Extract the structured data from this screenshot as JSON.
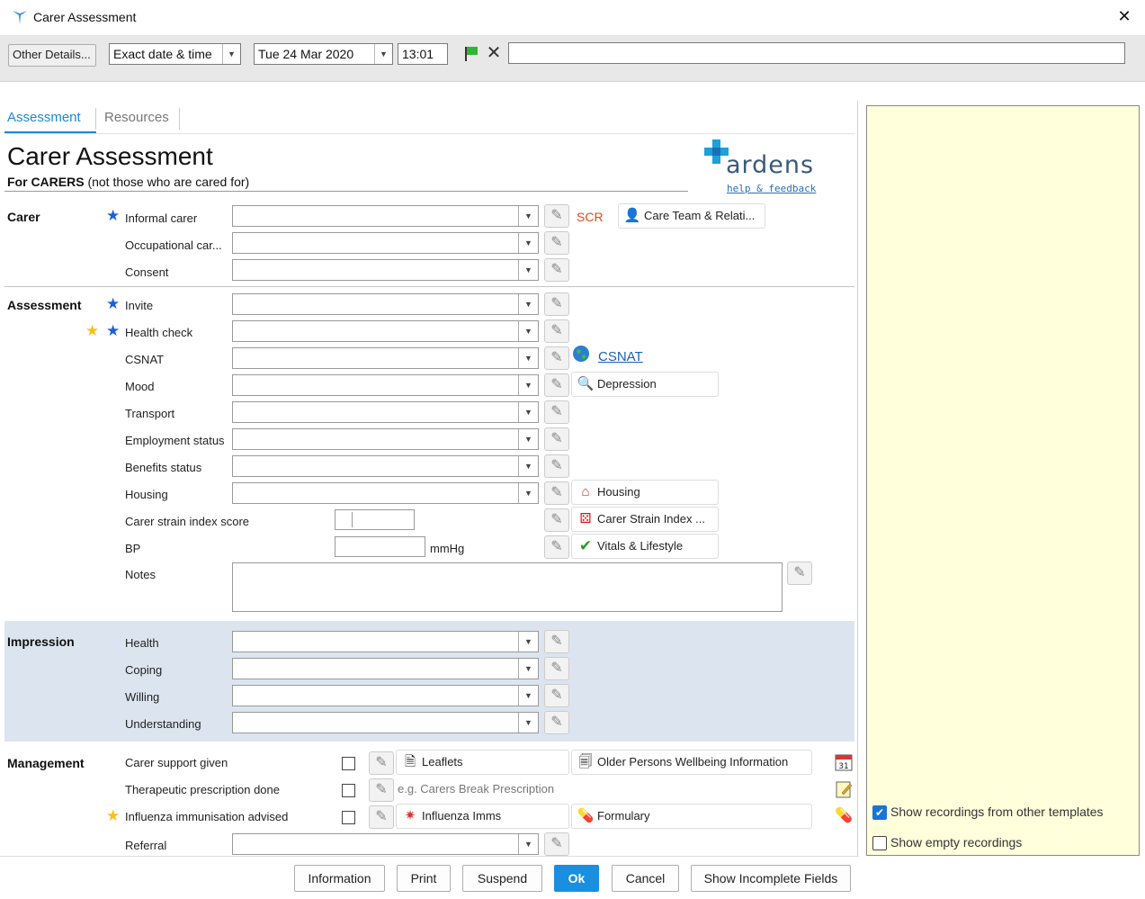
{
  "window": {
    "title": "Carer Assessment"
  },
  "toolbar": {
    "other_details": "Other Details...",
    "date_mode": "Exact date & time",
    "date": "Tue 24 Mar 2020",
    "time": "13:01"
  },
  "tabs": [
    {
      "label": "Assessment"
    },
    {
      "label": "Resources"
    }
  ],
  "heading": {
    "title": "Carer Assessment",
    "subtitle_bold": "For CARERS",
    "subtitle_rest": " (not those who are cared for)"
  },
  "logo": {
    "text": "ardens",
    "link": "help & feedback"
  },
  "sections": {
    "carer": "Carer",
    "assessment": "Assessment",
    "impression": "Impression",
    "management": "Management"
  },
  "fields": {
    "informal_carer": "Informal carer",
    "occupational_carer": "Occupational car...",
    "consent": "Consent",
    "invite": "Invite",
    "health_check": "Health check",
    "csnat": "CSNAT",
    "mood": "Mood",
    "transport": "Transport",
    "employment_status": "Employment status",
    "benefits_status": "Benefits status",
    "housing": "Housing",
    "carer_strain_index": "Carer strain index score",
    "bp": "BP",
    "bp_unit": "mmHg",
    "notes": "Notes",
    "health": "Health",
    "coping": "Coping",
    "willing": "Willing",
    "understanding": "Understanding",
    "carer_support_given": "Carer support given",
    "therapeutic_prescription": "Therapeutic prescription done",
    "influenza_advised": "Influenza immunisation advised",
    "referral": "Referral",
    "therapeutic_placeholder": "e.g. Carers Break Prescription"
  },
  "links": {
    "scr": "SCR",
    "care_team": "Care Team & Relati...",
    "csnat": "CSNAT",
    "depression": "Depression",
    "housing": "Housing",
    "carer_strain_index": "Carer Strain Index ...",
    "vitals": "Vitals & Lifestyle",
    "leaflets": "Leaflets",
    "older_persons": "Older Persons Wellbeing Information",
    "influenza_imms": "Influenza Imms",
    "formulary": "Formulary"
  },
  "side_panel": {
    "show_other": "Show recordings from other templates",
    "show_other_checked": true,
    "show_empty": "Show empty recordings",
    "show_empty_checked": false
  },
  "buttons": {
    "information": "Information",
    "print": "Print",
    "suspend": "Suspend",
    "ok": "Ok",
    "cancel": "Cancel",
    "show_incomplete": "Show Incomplete Fields"
  },
  "colors": {
    "accent": "#1f86d4",
    "ok_button": "#1a8fe0",
    "side_panel": "#ffffdc",
    "impression_band": "#dce5ef",
    "scr_red": "#e04a1a"
  }
}
